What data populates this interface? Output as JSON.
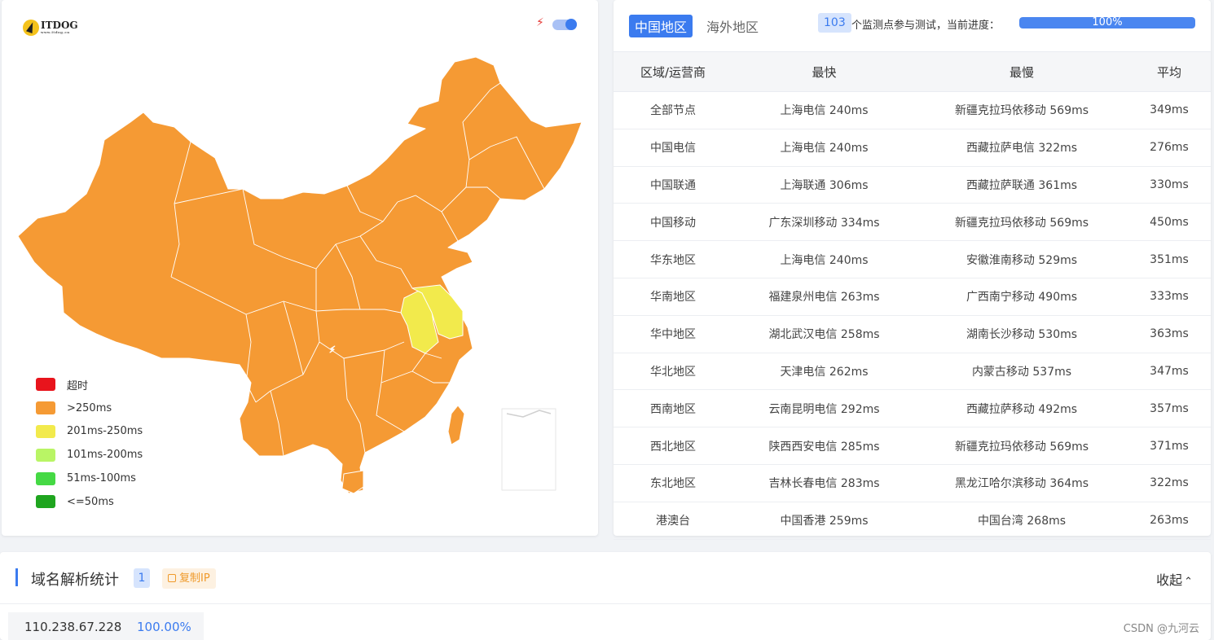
{
  "logo": {
    "text": "ITDOG",
    "sub": "www.itdog.cn"
  },
  "toolbar": {
    "bolt_icon": "⚡",
    "toggle_on": true
  },
  "colors": {
    "primary": "#3b7bef",
    "map_slow": "#f59a34",
    "map_medium": "#f2ea4c",
    "map_border": "#ffffff"
  },
  "legend": [
    {
      "label": "超时",
      "color": "#e8141c"
    },
    {
      "label": ">250ms",
      "color": "#f59a34"
    },
    {
      "label": "201ms-250ms",
      "color": "#f2ea4c"
    },
    {
      "label": "101ms-200ms",
      "color": "#b9f565"
    },
    {
      "label": "51ms-100ms",
      "color": "#45d944"
    },
    {
      "label": "<=50ms",
      "color": "#1fa51f"
    }
  ],
  "tabs": {
    "domestic": "中国地区",
    "overseas": "海外地区"
  },
  "progress": {
    "count": "103",
    "text": "个监测点参与测试，当前进度：",
    "label": "100%",
    "value": 1.0
  },
  "table": {
    "headers": [
      "区域/运营商",
      "最快",
      "最慢",
      "平均"
    ],
    "rows": [
      [
        "全部节点",
        "上海电信 240ms",
        "新疆克拉玛依移动 569ms",
        "349ms"
      ],
      [
        "中国电信",
        "上海电信 240ms",
        "西藏拉萨电信 322ms",
        "276ms"
      ],
      [
        "中国联通",
        "上海联通 306ms",
        "西藏拉萨联通 361ms",
        "330ms"
      ],
      [
        "中国移动",
        "广东深圳移动 334ms",
        "新疆克拉玛依移动 569ms",
        "450ms"
      ],
      [
        "华东地区",
        "上海电信 240ms",
        "安徽淮南移动 529ms",
        "351ms"
      ],
      [
        "华南地区",
        "福建泉州电信 263ms",
        "广西南宁移动 490ms",
        "333ms"
      ],
      [
        "华中地区",
        "湖北武汉电信 258ms",
        "湖南长沙移动 530ms",
        "363ms"
      ],
      [
        "华北地区",
        "天津电信 262ms",
        "内蒙古移动 537ms",
        "347ms"
      ],
      [
        "西南地区",
        "云南昆明电信 292ms",
        "西藏拉萨移动 492ms",
        "357ms"
      ],
      [
        "西北地区",
        "陕西西安电信 285ms",
        "新疆克拉玛依移动 569ms",
        "371ms"
      ],
      [
        "东北地区",
        "吉林长春电信 283ms",
        "黑龙江哈尔滨移动 364ms",
        "322ms"
      ],
      [
        "港澳台",
        "中国香港 259ms",
        "中国台湾 268ms",
        "263ms"
      ]
    ]
  },
  "dns": {
    "title": "域名解析统计",
    "count": "1",
    "copy_label": "复制IP",
    "collapse_label": "收起",
    "collapse_icon": "⌃",
    "ips": [
      {
        "ip": "110.238.67.228",
        "pct": "100.00%"
      }
    ]
  },
  "watermark": "CSDN @九河云"
}
